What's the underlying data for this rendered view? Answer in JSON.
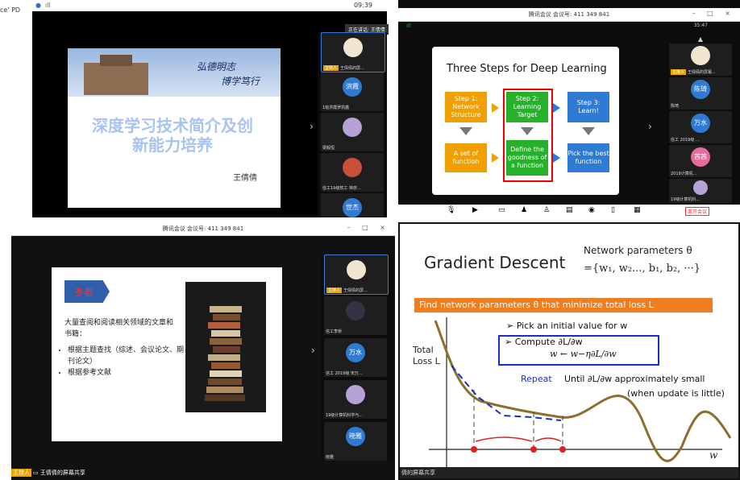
{
  "q1": {
    "left_label": "ce'",
    "left_label2": "PD",
    "time": "09:39",
    "speaking_badge": "正在讲话: 王倩倩",
    "slide": {
      "calligraphy1": "弘德明志",
      "calligraphy2": "博学笃行",
      "title_line1": "深度学习技术简介及创",
      "title_line2": "新能力培养",
      "author": "王倩倩"
    },
    "participants": [
      {
        "avatar": "",
        "caption": "王倩倩的屏..."
      },
      {
        "avatar": "洪霞",
        "caption": "1班洪霞罗凯鑫"
      },
      {
        "avatar": "",
        "caption": "梁毅恒"
      },
      {
        "avatar": "",
        "caption": "信工19级软工 林彦..."
      },
      {
        "avatar": "世杰",
        "caption": "世杰"
      }
    ],
    "host_tag": "主持人"
  },
  "q2": {
    "window_title": "腾讯会议 会议号: 411 349 841",
    "time": "35:47",
    "slide": {
      "title": "Three Steps for Deep Learning",
      "step1": "Step 1: Network Structure",
      "step2": "Step 2: Learning Target",
      "step3": "Step 3: Learn!",
      "box4": "A set of function",
      "box5": "Define the goodness of a function",
      "box6": "Pick the best function"
    },
    "participants": [
      {
        "avatar": "",
        "caption": "王倩倩的屏幕..."
      },
      {
        "avatar": "陈琦",
        "caption": "陈琦"
      },
      {
        "avatar": "万水",
        "caption": "信工 2019级 ..."
      },
      {
        "avatar": "茜茜",
        "caption": "2019计算机..."
      },
      {
        "avatar": "",
        "caption": "19级计算机科..."
      }
    ],
    "leave_button": "离开会议"
  },
  "q3": {
    "window_title": "腾讯会议 会议号: 411 349 841",
    "slide": {
      "badge": "多看",
      "para": "大量查阅和阅读相关领域的文章和书籍：",
      "bullet1": "根据主题查找（综述、会议论文、期刊论文）",
      "bullet2": "根据参考文献"
    },
    "participants": [
      {
        "avatar": "",
        "caption": "王倩倩的屏..."
      },
      {
        "avatar": "",
        "caption": "信工李桥"
      },
      {
        "avatar": "万水",
        "caption": "信工 2019级 宋万..."
      },
      {
        "avatar": "",
        "caption": "19级计算机科学与..."
      },
      {
        "avatar": "晓雅",
        "caption": "晓雅"
      }
    ],
    "share_label": "王倩倩的屏幕共享",
    "host_tag": "主持人"
  },
  "q4": {
    "slide": {
      "title": "Gradient Descent",
      "params_label": "Network parameters θ",
      "params_set": "={w₁, w₂..., b₁, b₂, ···}",
      "banner": "Find network parameters θ that minimize total loss L",
      "pick": "Pick an initial value for w",
      "compute": "Compute ∂L/∂w",
      "update": "w ← w−η∂L/∂w",
      "repeat": "Repeat",
      "until": "Until ∂L/∂w approximately small",
      "when": "(when update is little)",
      "total_loss": "Total Loss L",
      "w_axis": "w"
    },
    "share_label": "倩的屏幕共享"
  },
  "colors": {
    "host": "#e8a300",
    "blue_box": "#2f7bd3",
    "orange_box": "#f2a000",
    "green_box": "#27b02a",
    "banner": "#f07e1f"
  }
}
